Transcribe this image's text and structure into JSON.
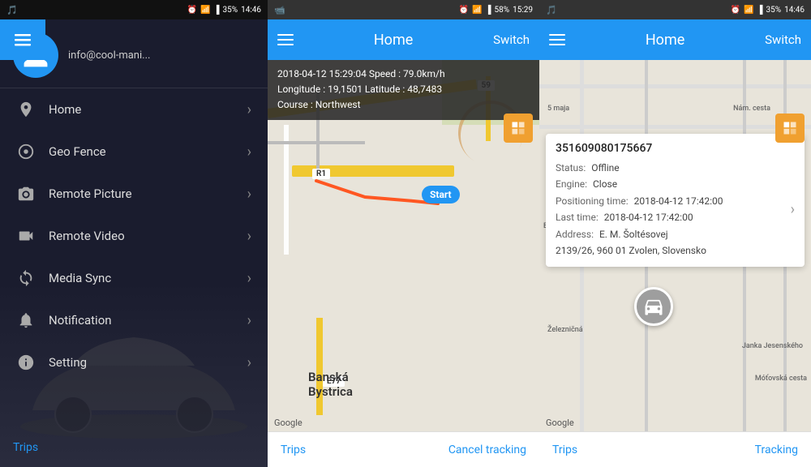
{
  "panel1": {
    "statusBar": {
      "left": "🎵",
      "time": "14:46",
      "battery": "35%",
      "icons": [
        "alarm",
        "wifi",
        "signal"
      ]
    },
    "profile": {
      "email": "info@cool-mani..."
    },
    "tabs": {
      "icon": "menu"
    },
    "menuItems": [
      {
        "id": "home",
        "label": "Home",
        "icon": "location"
      },
      {
        "id": "geofence",
        "label": "Geo Fence",
        "icon": "gear-circle"
      },
      {
        "id": "remote-picture",
        "label": "Remote Picture",
        "icon": "camera"
      },
      {
        "id": "remote-video",
        "label": "Remote Video",
        "icon": "video"
      },
      {
        "id": "media-sync",
        "label": "Media Sync",
        "icon": "sync"
      },
      {
        "id": "notification",
        "label": "Notification",
        "icon": "bell"
      },
      {
        "id": "setting",
        "label": "Setting",
        "icon": "info"
      }
    ],
    "tripsLabel": "Trips"
  },
  "panel2": {
    "statusBar": {
      "left": "📹",
      "time": "15:29",
      "battery": "58%"
    },
    "appBar": {
      "title": "Home",
      "switchLabel": "Switch"
    },
    "infoOverlay": {
      "line1": "2018-04-12 15:29:04   Speed : 79.0km/h",
      "line2": "Longitude : 19,1501   Latitude : 48,7483",
      "line3": "Course : Northwest"
    },
    "startMarker": "Start",
    "googleLabel": "Google",
    "bottomBar": {
      "left": "Trips",
      "right": "Cancel tracking"
    },
    "mapElements": {
      "r1Label": "R1",
      "e77Label": "E77",
      "cityLabel": "Banská\nBystrica",
      "road59": "59"
    }
  },
  "panel3": {
    "statusBar": {
      "left": "🎵",
      "time": "14:46",
      "battery": "35%"
    },
    "appBar": {
      "title": "Home",
      "switchLabel": "Switch"
    },
    "vehiclePopup": {
      "deviceId": "351609080175667",
      "statusLabel": "Status:",
      "statusValue": "Offline",
      "engineLabel": "Engine:",
      "engineValue": "Close",
      "positioningLabel": "Positioning time:",
      "positioningValue": "2018-04-12 17:42:00",
      "lastTimeLabel": "Last time:",
      "lastTimeValue": "2018-04-12 17:42:00",
      "addressLabel": "Address:",
      "addressValue": "E. M. Šoltésovej\n2139/26, 960 01 Zvolen, Slovensko"
    },
    "googleLabel": "Google",
    "bottomBar": {
      "left": "Trips",
      "right": "Tracking"
    }
  }
}
